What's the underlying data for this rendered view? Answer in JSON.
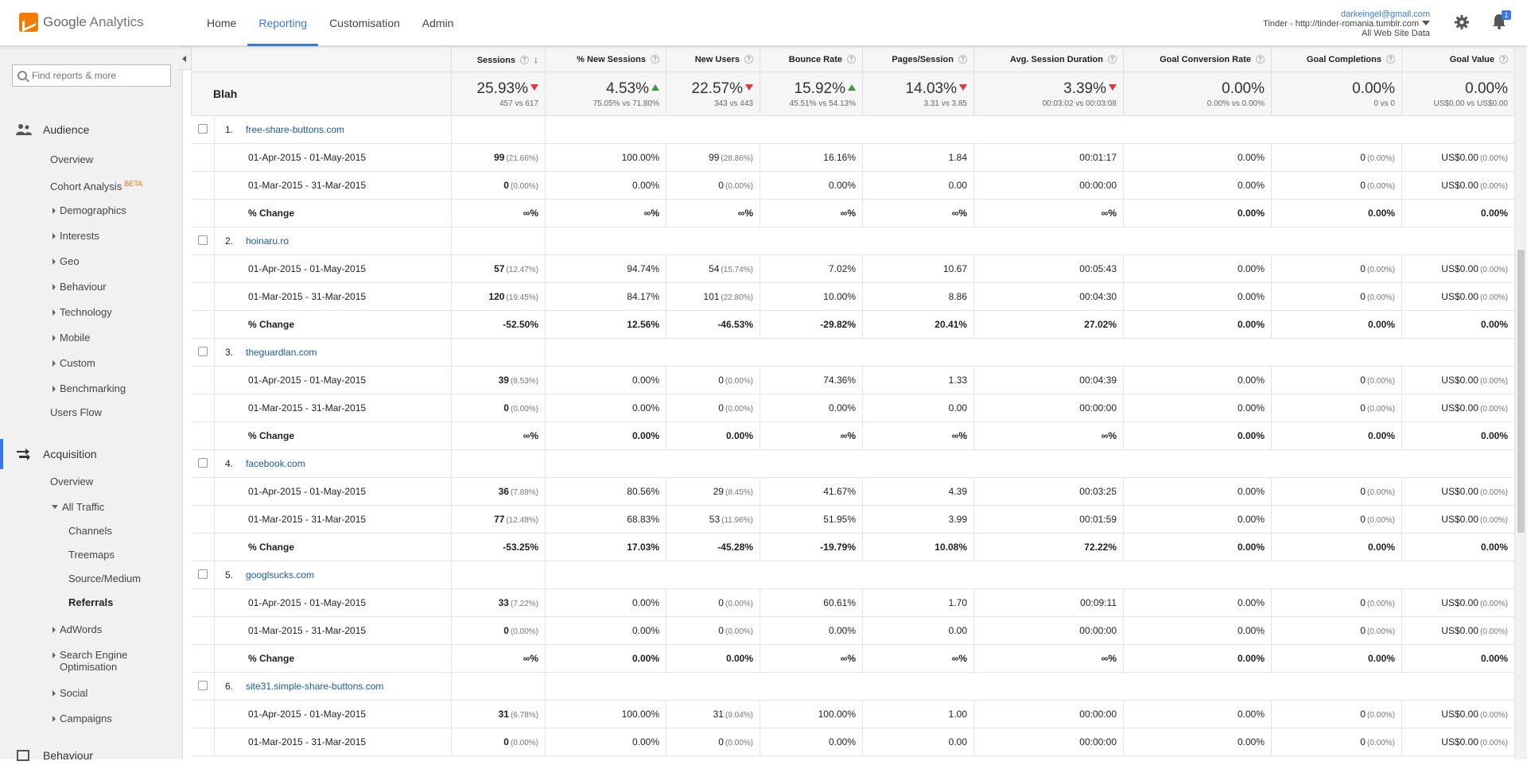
{
  "app": {
    "brand_google": "Google",
    "brand_name": "Analytics"
  },
  "nav": {
    "tabs": [
      "Home",
      "Reporting",
      "Customisation",
      "Admin"
    ],
    "active": 1
  },
  "account": {
    "email": "darkeingel@gmail.com",
    "property": "Tinder - http://tinder-romania.tumblr.com",
    "view": "All Web Site Data"
  },
  "notifications": {
    "count": "1"
  },
  "sidebar": {
    "search_placeholder": "Find reports & more",
    "audience_label": "Audience",
    "audience_items": [
      "Overview",
      "Cohort Analysis",
      "Demographics",
      "Interests",
      "Geo",
      "Behaviour",
      "Technology",
      "Mobile",
      "Custom",
      "Benchmarking",
      "Users Flow"
    ],
    "beta_label": "BETA",
    "acquisition_label": "Acquisition",
    "acquisition_items": [
      "Overview",
      "All Traffic",
      "Channels",
      "Treemaps",
      "Source/Medium",
      "Referrals",
      "AdWords",
      "Search Engine",
      "Optimisation",
      "Social",
      "Campaigns"
    ],
    "behaviour_label": "Behaviour"
  },
  "table": {
    "headers": [
      "Sessions",
      "% New Sessions",
      "New Users",
      "Bounce Rate",
      "Pages/Session",
      "Avg. Session Duration",
      "Goal Conversion Rate",
      "Goal Completions",
      "Goal Value"
    ],
    "summary": {
      "title": "Blah",
      "values": [
        "25.93%",
        "4.53%",
        "22.57%",
        "15.92%",
        "14.03%",
        "3.39%",
        "0.00%",
        "0.00%",
        "0.00%"
      ],
      "directions": [
        "down",
        "up",
        "down",
        "up",
        "down",
        "down",
        "",
        "",
        ""
      ],
      "subs": [
        "457 vs 617",
        "75.05% vs 71.80%",
        "343 vs 443",
        "45.51% vs 54.13%",
        "3.31 vs 3.85",
        "00:03:02 vs 00:03:08",
        "0.00% vs 0.00%",
        "0 vs 0",
        "US$0.00 vs US$0.00"
      ]
    },
    "change_label": "% Change",
    "sources": [
      {
        "num": "1.",
        "name": "free-share-buttons.com",
        "rows": [
          {
            "range": "01-Apr-2015 - 01-May-2015",
            "cells": [
              [
                "99",
                "(21.66%)"
              ],
              [
                "100.00%",
                ""
              ],
              [
                "99",
                "(28.86%)"
              ],
              [
                "16.16%",
                ""
              ],
              [
                "1.84",
                ""
              ],
              [
                "00:01:17",
                ""
              ],
              [
                "0.00%",
                ""
              ],
              [
                "0",
                "(0.00%)"
              ],
              [
                "US$0.00",
                "(0.00%)"
              ]
            ]
          },
          {
            "range": "01-Mar-2015 - 31-Mar-2015",
            "cells": [
              [
                "0",
                "(0.00%)"
              ],
              [
                "0.00%",
                ""
              ],
              [
                "0",
                "(0.00%)"
              ],
              [
                "0.00%",
                ""
              ],
              [
                "0.00",
                ""
              ],
              [
                "00:00:00",
                ""
              ],
              [
                "0.00%",
                ""
              ],
              [
                "0",
                "(0.00%)"
              ],
              [
                "US$0.00",
                "(0.00%)"
              ]
            ]
          }
        ],
        "change": [
          "∞%",
          "∞%",
          "∞%",
          "∞%",
          "∞%",
          "∞%",
          "0.00%",
          "0.00%",
          "0.00%"
        ]
      },
      {
        "num": "2.",
        "name": "hoinaru.ro",
        "rows": [
          {
            "range": "01-Apr-2015 - 01-May-2015",
            "cells": [
              [
                "57",
                "(12.47%)"
              ],
              [
                "94.74%",
                ""
              ],
              [
                "54",
                "(15.74%)"
              ],
              [
                "7.02%",
                ""
              ],
              [
                "10.67",
                ""
              ],
              [
                "00:05:43",
                ""
              ],
              [
                "0.00%",
                ""
              ],
              [
                "0",
                "(0.00%)"
              ],
              [
                "US$0.00",
                "(0.00%)"
              ]
            ]
          },
          {
            "range": "01-Mar-2015 - 31-Mar-2015",
            "cells": [
              [
                "120",
                "(19.45%)"
              ],
              [
                "84.17%",
                ""
              ],
              [
                "101",
                "(22.80%)"
              ],
              [
                "10.00%",
                ""
              ],
              [
                "8.86",
                ""
              ],
              [
                "00:04:30",
                ""
              ],
              [
                "0.00%",
                ""
              ],
              [
                "0",
                "(0.00%)"
              ],
              [
                "US$0.00",
                "(0.00%)"
              ]
            ]
          }
        ],
        "change": [
          "-52.50%",
          "12.56%",
          "-46.53%",
          "-29.82%",
          "20.41%",
          "27.02%",
          "0.00%",
          "0.00%",
          "0.00%"
        ]
      },
      {
        "num": "3.",
        "name": "theguardlan.com",
        "rows": [
          {
            "range": "01-Apr-2015 - 01-May-2015",
            "cells": [
              [
                "39",
                "(8.53%)"
              ],
              [
                "0.00%",
                ""
              ],
              [
                "0",
                "(0.00%)"
              ],
              [
                "74.36%",
                ""
              ],
              [
                "1.33",
                ""
              ],
              [
                "00:04:39",
                ""
              ],
              [
                "0.00%",
                ""
              ],
              [
                "0",
                "(0.00%)"
              ],
              [
                "US$0.00",
                "(0.00%)"
              ]
            ]
          },
          {
            "range": "01-Mar-2015 - 31-Mar-2015",
            "cells": [
              [
                "0",
                "(0.00%)"
              ],
              [
                "0.00%",
                ""
              ],
              [
                "0",
                "(0.00%)"
              ],
              [
                "0.00%",
                ""
              ],
              [
                "0.00",
                ""
              ],
              [
                "00:00:00",
                ""
              ],
              [
                "0.00%",
                ""
              ],
              [
                "0",
                "(0.00%)"
              ],
              [
                "US$0.00",
                "(0.00%)"
              ]
            ]
          }
        ],
        "change": [
          "∞%",
          "0.00%",
          "0.00%",
          "∞%",
          "∞%",
          "∞%",
          "0.00%",
          "0.00%",
          "0.00%"
        ]
      },
      {
        "num": "4.",
        "name": "facebook.com",
        "rows": [
          {
            "range": "01-Apr-2015 - 01-May-2015",
            "cells": [
              [
                "36",
                "(7.88%)"
              ],
              [
                "80.56%",
                ""
              ],
              [
                "29",
                "(8.45%)"
              ],
              [
                "41.67%",
                ""
              ],
              [
                "4.39",
                ""
              ],
              [
                "00:03:25",
                ""
              ],
              [
                "0.00%",
                ""
              ],
              [
                "0",
                "(0.00%)"
              ],
              [
                "US$0.00",
                "(0.00%)"
              ]
            ]
          },
          {
            "range": "01-Mar-2015 - 31-Mar-2015",
            "cells": [
              [
                "77",
                "(12.48%)"
              ],
              [
                "68.83%",
                ""
              ],
              [
                "53",
                "(11.96%)"
              ],
              [
                "51.95%",
                ""
              ],
              [
                "3.99",
                ""
              ],
              [
                "00:01:59",
                ""
              ],
              [
                "0.00%",
                ""
              ],
              [
                "0",
                "(0.00%)"
              ],
              [
                "US$0.00",
                "(0.00%)"
              ]
            ]
          }
        ],
        "change": [
          "-53.25%",
          "17.03%",
          "-45.28%",
          "-19.79%",
          "10.08%",
          "72.22%",
          "0.00%",
          "0.00%",
          "0.00%"
        ]
      },
      {
        "num": "5.",
        "name": "googlsucks.com",
        "rows": [
          {
            "range": "01-Apr-2015 - 01-May-2015",
            "cells": [
              [
                "33",
                "(7.22%)"
              ],
              [
                "0.00%",
                ""
              ],
              [
                "0",
                "(0.00%)"
              ],
              [
                "60.61%",
                ""
              ],
              [
                "1.70",
                ""
              ],
              [
                "00:09:11",
                ""
              ],
              [
                "0.00%",
                ""
              ],
              [
                "0",
                "(0.00%)"
              ],
              [
                "US$0.00",
                "(0.00%)"
              ]
            ]
          },
          {
            "range": "01-Mar-2015 - 31-Mar-2015",
            "cells": [
              [
                "0",
                "(0.00%)"
              ],
              [
                "0.00%",
                ""
              ],
              [
                "0",
                "(0.00%)"
              ],
              [
                "0.00%",
                ""
              ],
              [
                "0.00",
                ""
              ],
              [
                "00:00:00",
                ""
              ],
              [
                "0.00%",
                ""
              ],
              [
                "0",
                "(0.00%)"
              ],
              [
                "US$0.00",
                "(0.00%)"
              ]
            ]
          }
        ],
        "change": [
          "∞%",
          "0.00%",
          "0.00%",
          "∞%",
          "∞%",
          "∞%",
          "0.00%",
          "0.00%",
          "0.00%"
        ]
      },
      {
        "num": "6.",
        "name": "site31.simple-share-buttons.com",
        "rows": [
          {
            "range": "01-Apr-2015 - 01-May-2015",
            "cells": [
              [
                "31",
                "(6.78%)"
              ],
              [
                "100.00%",
                ""
              ],
              [
                "31",
                "(9.04%)"
              ],
              [
                "100.00%",
                ""
              ],
              [
                "1.00",
                ""
              ],
              [
                "00:00:00",
                ""
              ],
              [
                "0.00%",
                ""
              ],
              [
                "0",
                "(0.00%)"
              ],
              [
                "US$0.00",
                "(0.00%)"
              ]
            ]
          },
          {
            "range": "01-Mar-2015 - 31-Mar-2015",
            "cells": [
              [
                "0",
                "(0.00%)"
              ],
              [
                "0.00%",
                ""
              ],
              [
                "0",
                "(0.00%)"
              ],
              [
                "0.00%",
                ""
              ],
              [
                "0.00",
                ""
              ],
              [
                "00:00:00",
                ""
              ],
              [
                "0.00%",
                ""
              ],
              [
                "0",
                "(0.00%)"
              ],
              [
                "US$0.00",
                "(0.00%)"
              ]
            ]
          }
        ],
        "change": null
      }
    ]
  }
}
